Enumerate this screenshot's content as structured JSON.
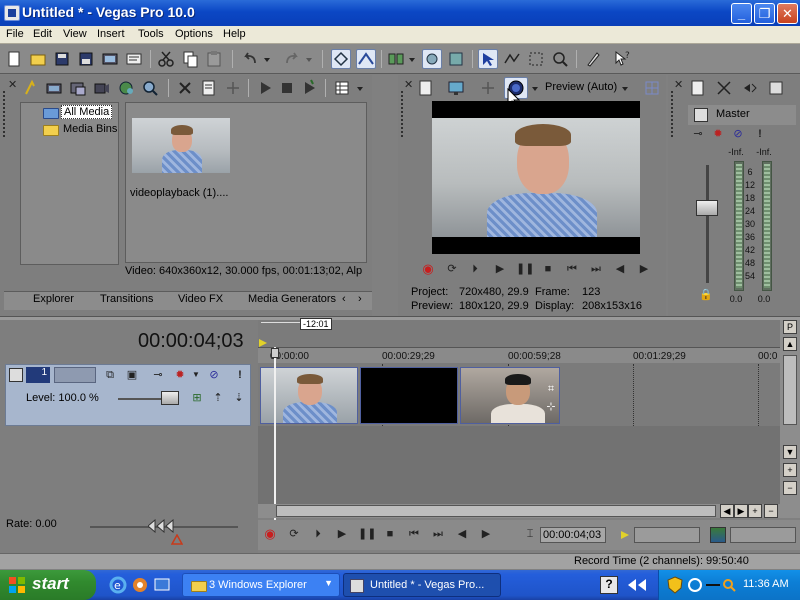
{
  "window": {
    "title": "Untitled * - Vegas Pro 10.0",
    "minimize_glyph": "_",
    "restore_glyph": "❐",
    "close_glyph": "✕"
  },
  "menu": [
    "File",
    "Edit",
    "View",
    "Insert",
    "Tools",
    "Options",
    "Help"
  ],
  "explorer": {
    "tree": [
      "All Media",
      "Media Bins"
    ],
    "media_file": "videoplayback (1)....",
    "media_info": "Video: 640x360x12, 30.000 fps, 00:01:13;02, Alp"
  },
  "tabs": [
    "Explorer",
    "Transitions",
    "Video FX",
    "Media Generators"
  ],
  "tab_nav": [
    "‹",
    "›"
  ],
  "preview": {
    "quality": "Preview (Auto)",
    "project_label": "Project:",
    "project_value": "720x480, 29.9",
    "preview_label": "Preview:",
    "preview_value": "180x120, 29.9",
    "frame_label": "Frame:",
    "frame_value": "123",
    "display_label": "Display:",
    "display_value": "208x153x16"
  },
  "mixer": {
    "master_label": "Master",
    "inf_left": "-Inf.",
    "inf_right": "-Inf.",
    "scale": [
      "6",
      "12",
      "18",
      "24",
      "30",
      "36",
      "42",
      "48",
      "54"
    ],
    "bottom_left": "0.0",
    "bottom_right": "0.0"
  },
  "timeline": {
    "timecode": "00:00:04;03",
    "marker_offset": "-12:01",
    "ruler": [
      "00:00:00",
      "00:00:29;29",
      "00:00:59;28",
      "00:01:29;29",
      "00:0"
    ],
    "track_number": "1",
    "level": "Level: 100.0 %",
    "rate": "Rate: 0.00",
    "transport_timecode": "00:00:04;03"
  },
  "status": {
    "record_time": "Record Time (2 channels): 99:50:40"
  },
  "taskbar": {
    "start_label": "start",
    "task1": "3 Windows Explorer",
    "task2": "Untitled * - Vegas Pro...",
    "clock": "11:36 AM"
  },
  "colors": {
    "titlebar": "#0b47c5",
    "panel": "#7e7e7e",
    "track_header": "#a7b6cd",
    "taskbar": "#245edb",
    "start": "#318a2e"
  }
}
